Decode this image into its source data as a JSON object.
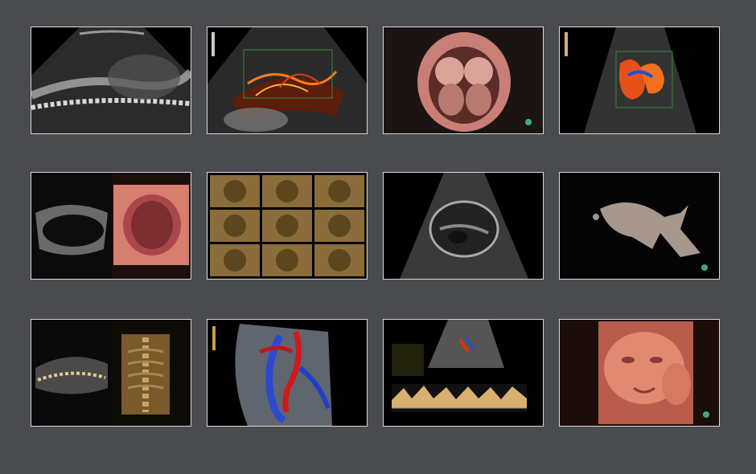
{
  "gallery": {
    "background": "#4a4b4f",
    "frame_color": "#d9d9d9",
    "tiles": [
      {
        "caption": "",
        "icon": "ultrasound-2d-icon"
      },
      {
        "caption": "",
        "icon": "color-doppler-icon"
      },
      {
        "caption": "",
        "icon": "render-3d-icon"
      },
      {
        "caption": "",
        "icon": "color-doppler-icon"
      },
      {
        "caption": "",
        "icon": "dual-view-icon"
      },
      {
        "caption": "",
        "icon": "multiplanar-grid-icon"
      },
      {
        "caption": "",
        "icon": "ultrasound-2d-icon"
      },
      {
        "caption": "",
        "icon": "render-3d-icon"
      },
      {
        "caption": "",
        "icon": "dual-view-icon"
      },
      {
        "caption": "",
        "icon": "color-doppler-icon"
      },
      {
        "caption": "",
        "icon": "spectral-doppler-icon"
      },
      {
        "caption": "",
        "icon": "render-3d-icon"
      }
    ]
  }
}
